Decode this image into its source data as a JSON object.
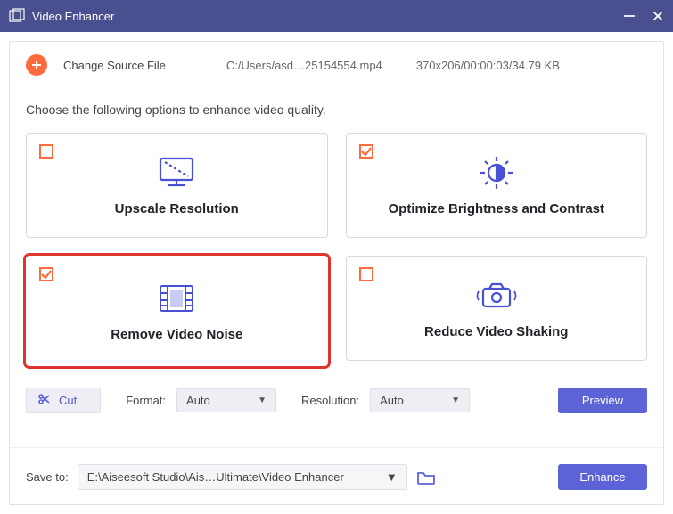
{
  "title": "Video Enhancer",
  "source": {
    "change_label": "Change Source File",
    "path": "C:/Users/asd…25154554.mp4",
    "meta": "370x206/00:00:03/34.79 KB"
  },
  "instruction": "Choose the following options to enhance video quality.",
  "cards": {
    "upscale": "Upscale Resolution",
    "brightness": "Optimize Brightness and Contrast",
    "noise": "Remove Video Noise",
    "shaking": "Reduce Video Shaking"
  },
  "toolbar": {
    "cut": "Cut",
    "format_label": "Format:",
    "format_value": "Auto",
    "resolution_label": "Resolution:",
    "resolution_value": "Auto",
    "preview": "Preview"
  },
  "save": {
    "label": "Save to:",
    "path": "E:\\Aiseesoft Studio\\Ais…Ultimate\\Video Enhancer",
    "enhance": "Enhance"
  },
  "colors": {
    "accent": "#5b63d6",
    "highlight": "#e0352f",
    "titlebar": "#4a4f8f",
    "orange": "#ff6b3d"
  }
}
